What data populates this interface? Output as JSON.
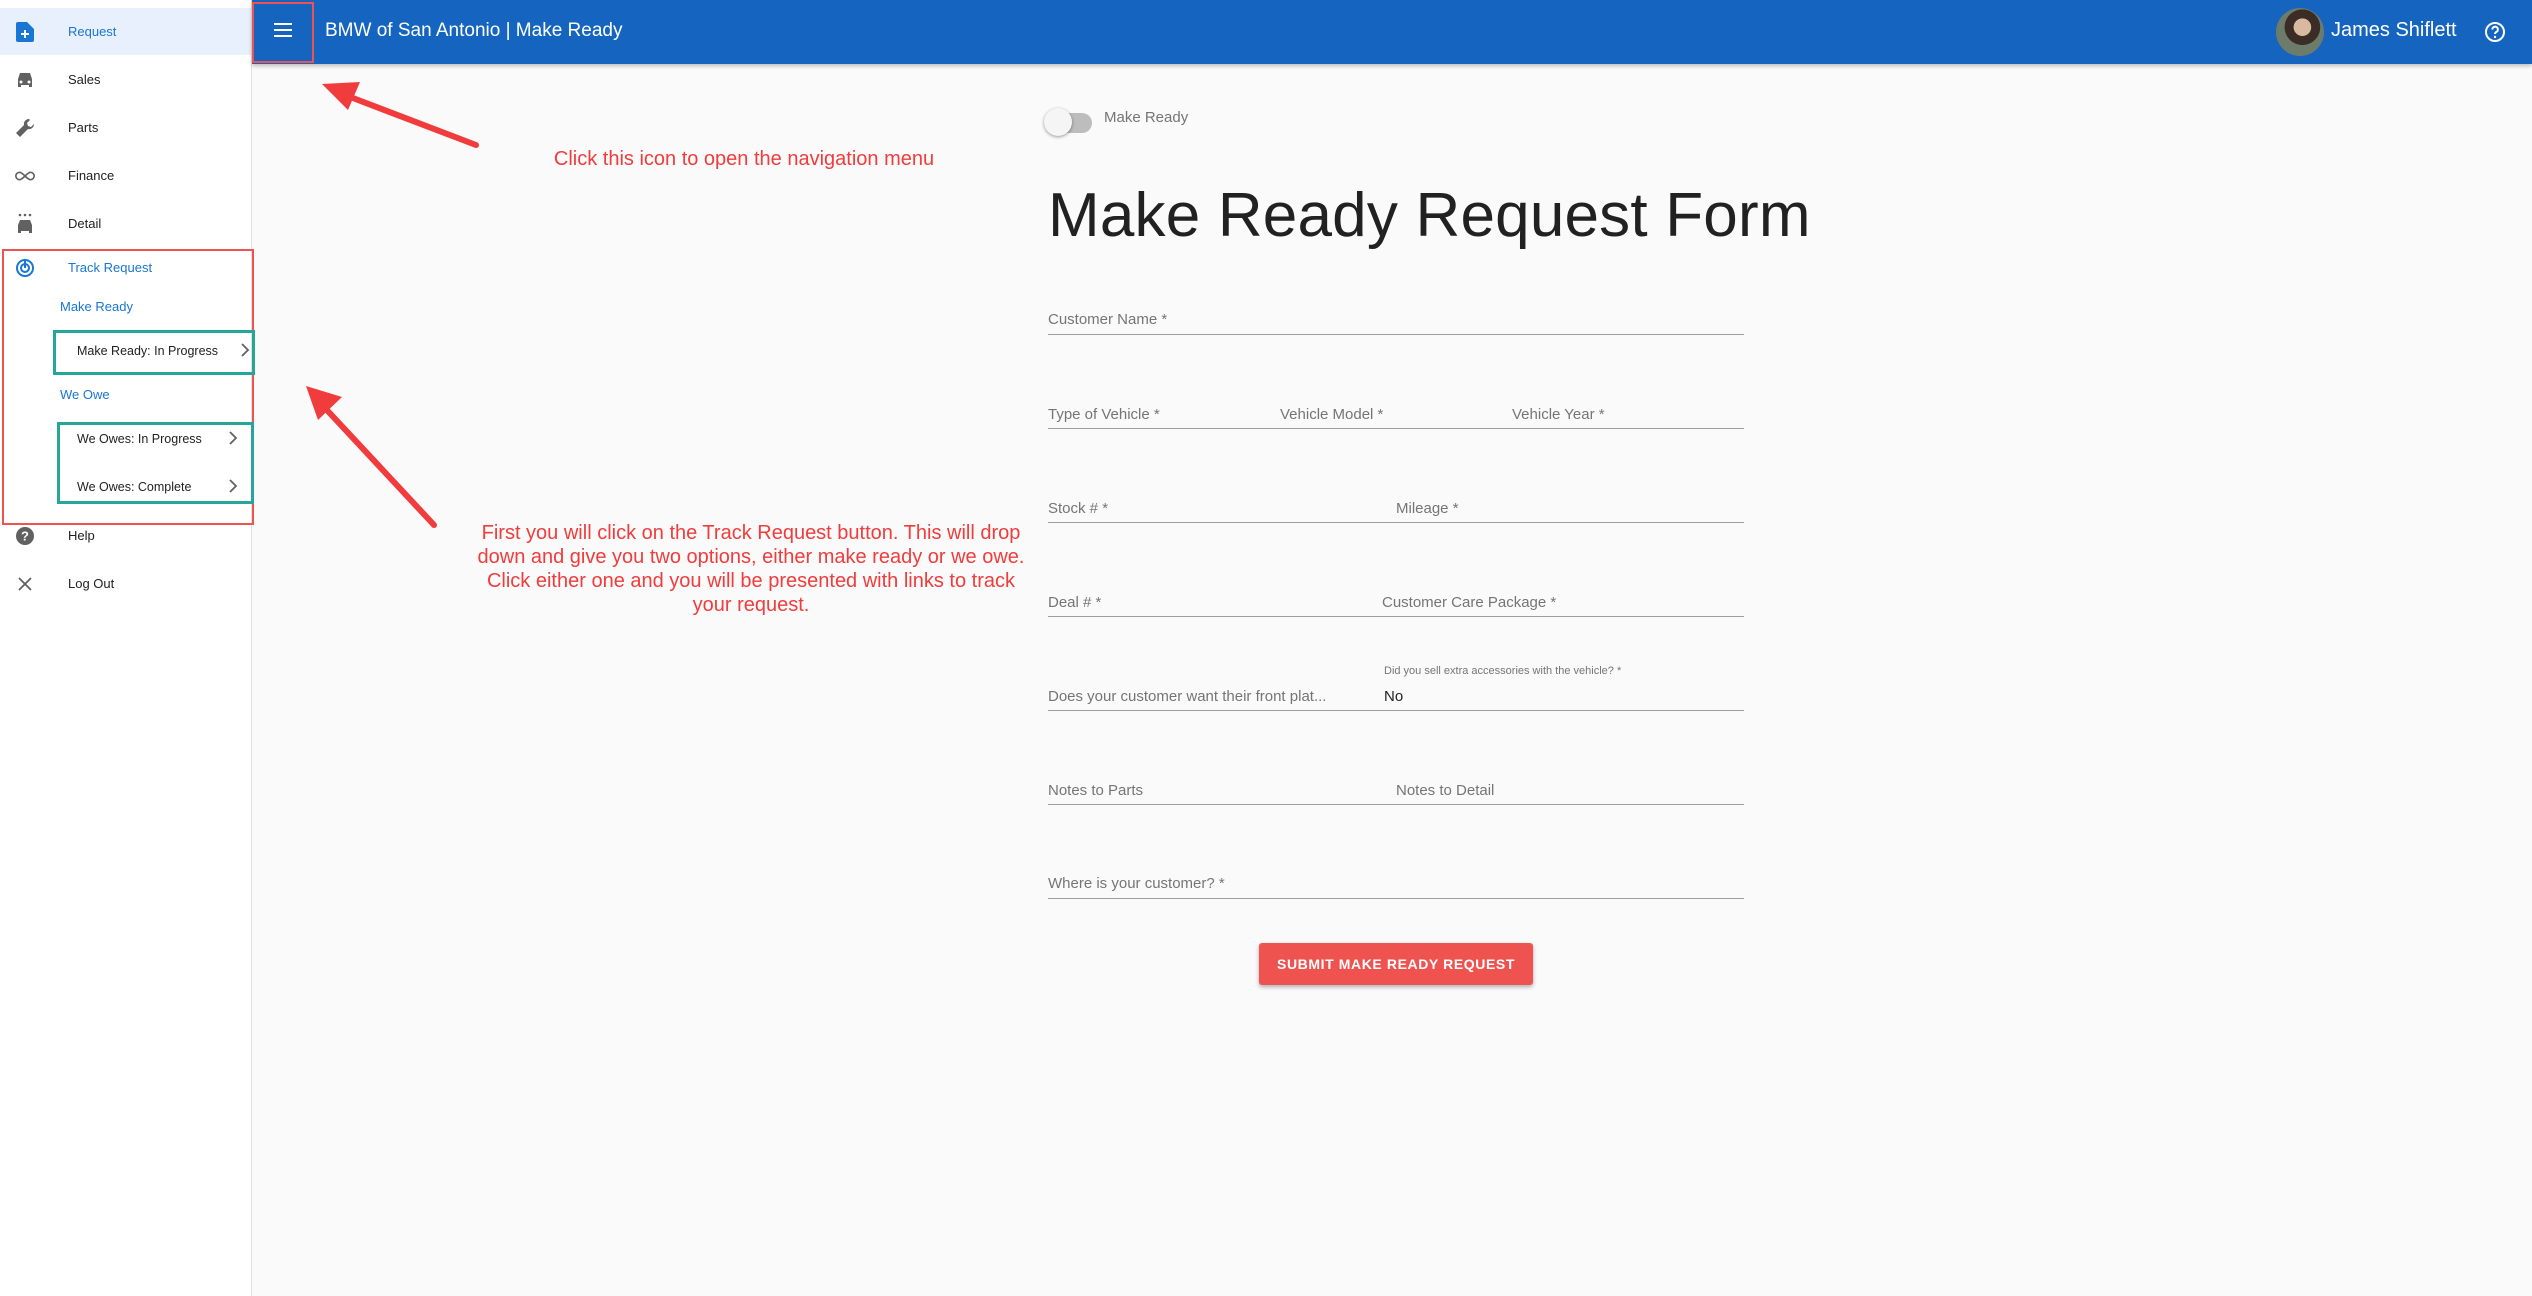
{
  "header": {
    "title": "BMW of San Antonio | Make Ready",
    "user_name": "James Shiflett"
  },
  "sidebar": {
    "items": [
      {
        "label": "Request",
        "icon": "add-document-icon"
      },
      {
        "label": "Sales",
        "icon": "car-icon"
      },
      {
        "label": "Parts",
        "icon": "wrench-icon"
      },
      {
        "label": "Finance",
        "icon": "infinity-icon"
      },
      {
        "label": "Detail",
        "icon": "car-wash-icon"
      },
      {
        "label": "Track Request",
        "icon": "track-changes-icon"
      },
      {
        "label": "Help",
        "icon": "help-icon"
      },
      {
        "label": "Log Out",
        "icon": "close-icon"
      }
    ],
    "make_ready_group": "Make Ready",
    "make_ready_in_progress": "Make Ready: In Progress",
    "we_owe_group": "We Owe",
    "we_owes_in_progress": "We Owes: In Progress",
    "we_owes_complete": "We Owes: Complete"
  },
  "toggle": {
    "label": "Make Ready",
    "checked": false
  },
  "form": {
    "title": "Make Ready Request Form",
    "customer_name": "Customer Name *",
    "type_of_vehicle": "Type of Vehicle *",
    "vehicle_model": "Vehicle Model *",
    "vehicle_year": "Vehicle Year *",
    "stock": "Stock # *",
    "mileage": "Mileage *",
    "deal": "Deal # *",
    "customer_care_package": "Customer Care Package *",
    "front_plate": "Does your customer want their front plat...",
    "accessories_label": "Did you sell extra accessories with the vehicle? *",
    "accessories_value": "No",
    "notes_parts": "Notes to Parts",
    "notes_detail": "Notes to Detail",
    "customer_location": "Where is your customer? *",
    "submit_label": "SUBMIT MAKE READY REQUEST"
  },
  "annotations": {
    "menu_hint": "Click this icon to open the navigation menu",
    "track_hint": "First you will click on the Track Request button. This will drop down and give you two options, either make ready or we owe. Click either one and you will be presented with links to track your request."
  },
  "colors": {
    "header": "#1565c0",
    "accent": "#1976d2",
    "submit": "#ef5350",
    "annotation": "#f03c3c",
    "highlight_green": "#26a69a"
  }
}
